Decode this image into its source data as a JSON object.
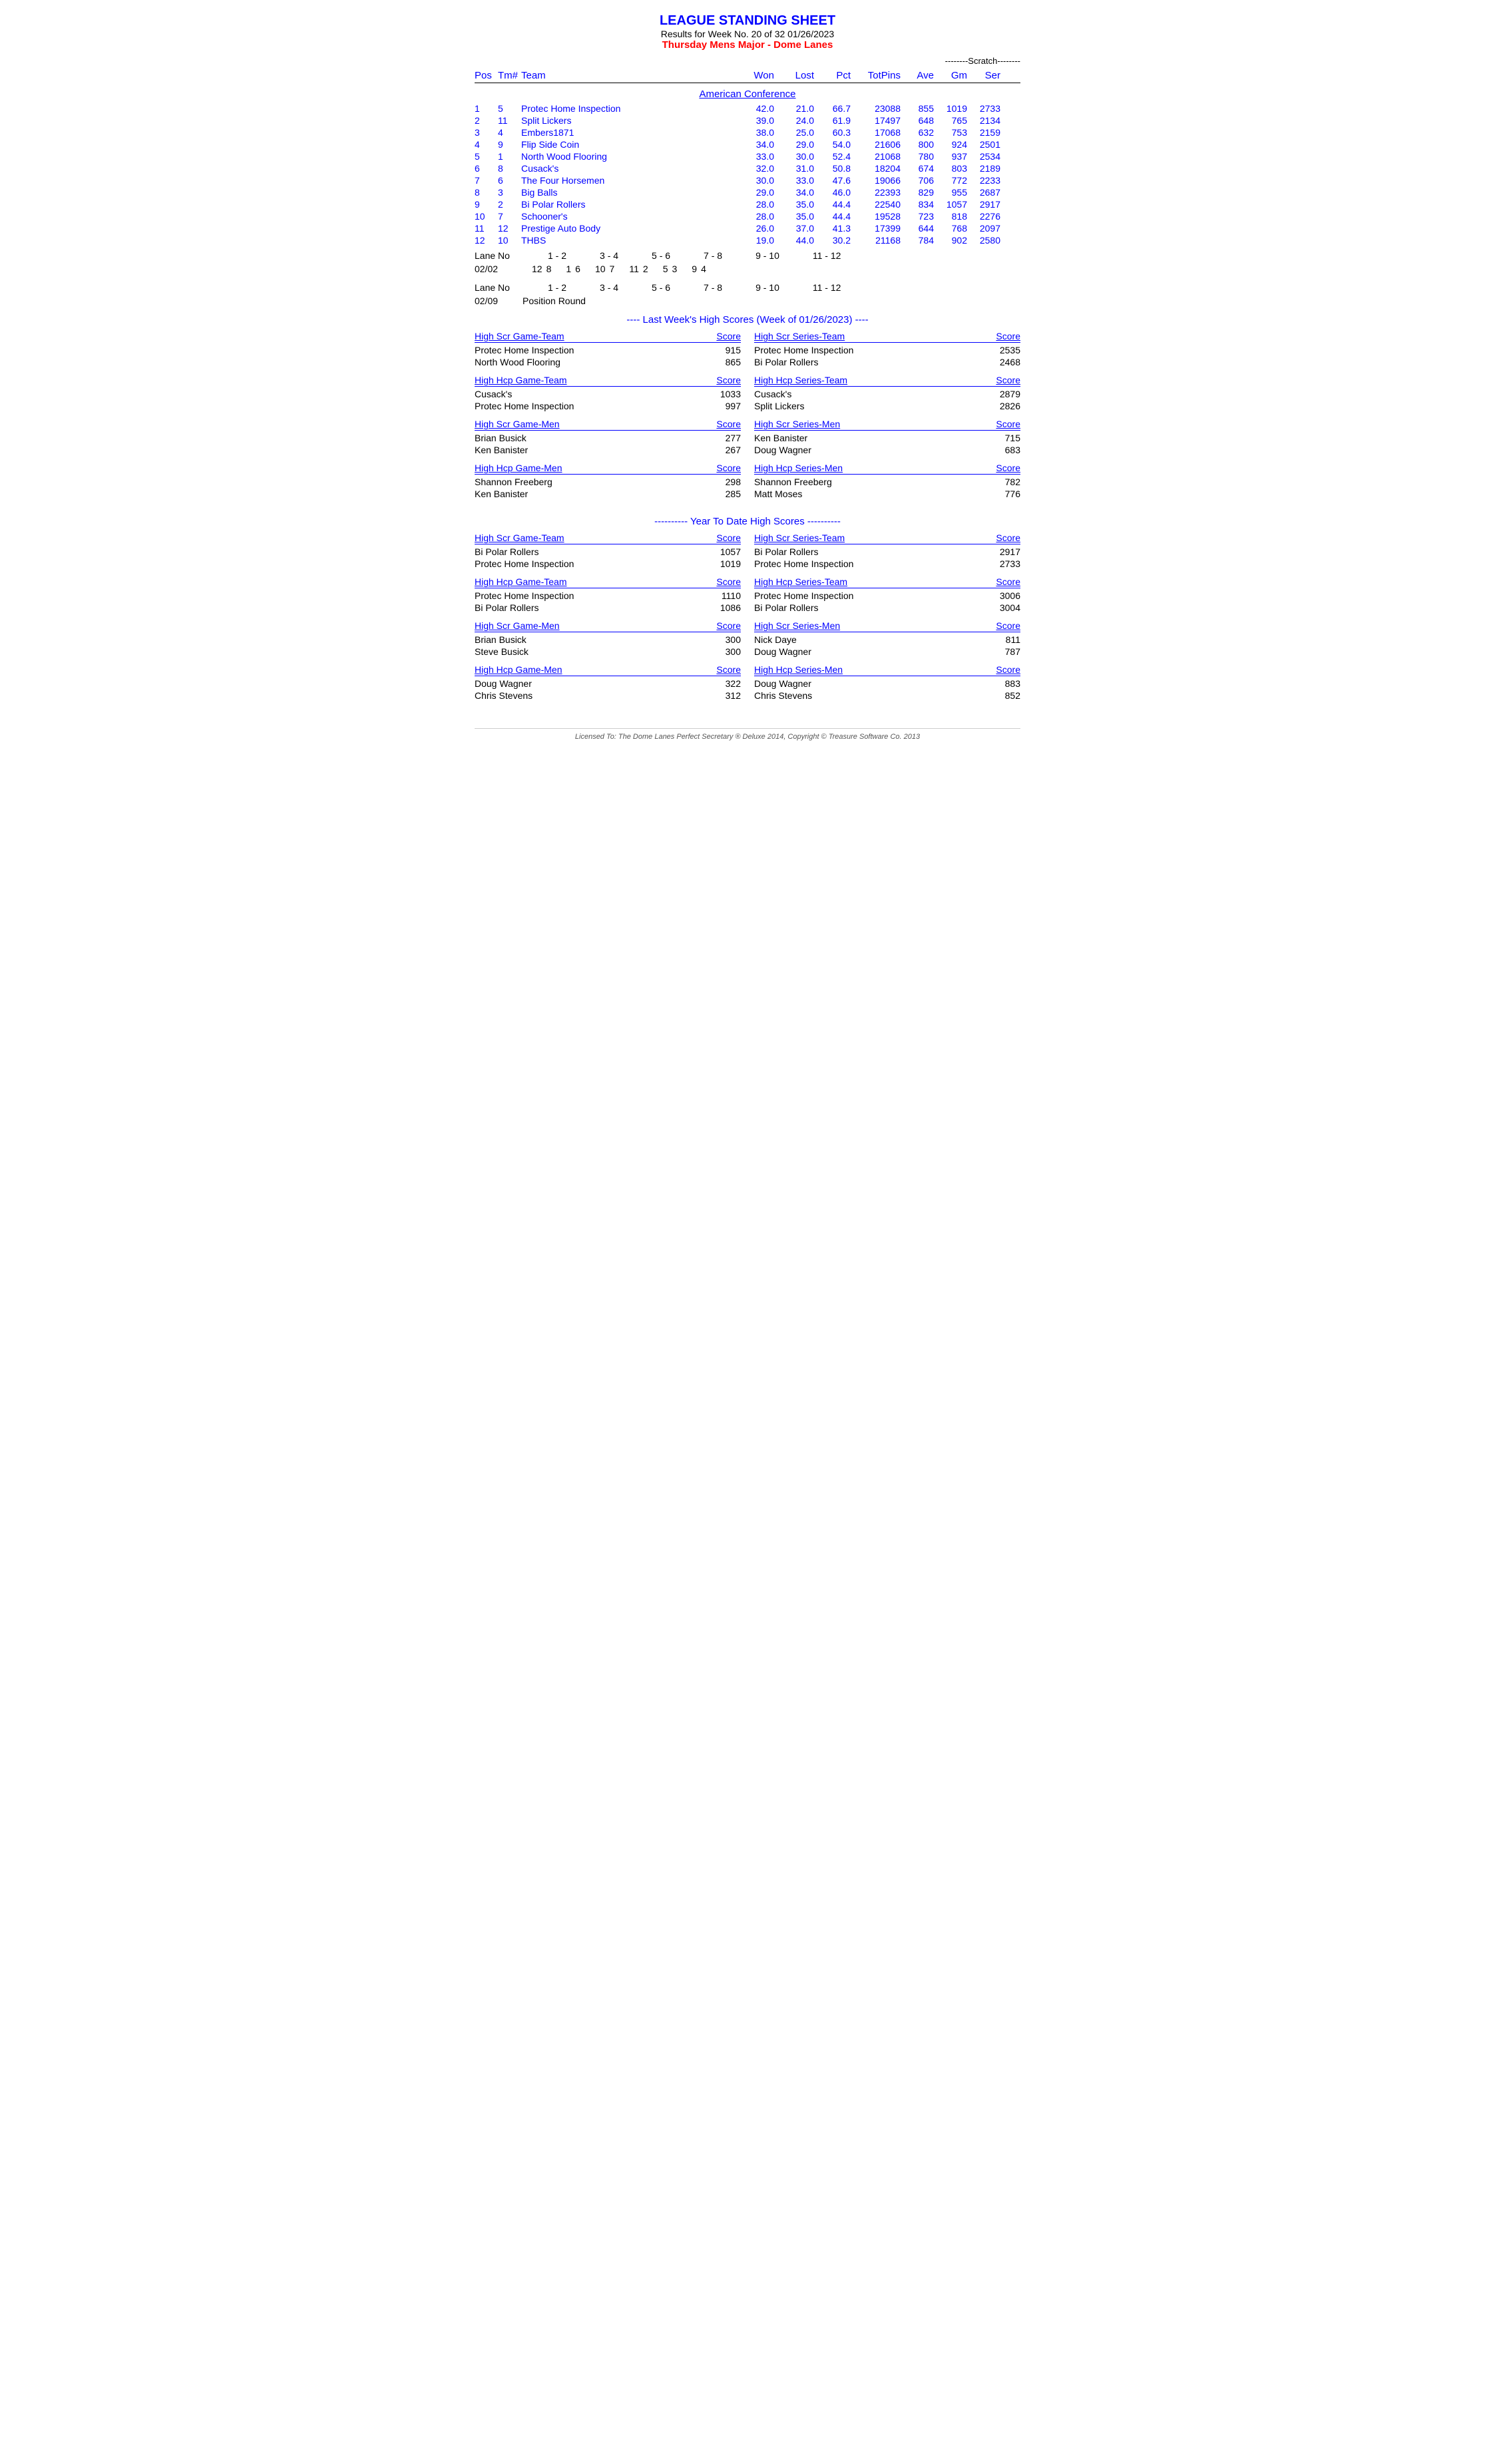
{
  "header": {
    "title": "LEAGUE STANDING SHEET",
    "subtitle": "Results for Week No. 20 of 32    01/26/2023",
    "league": "Thursday Mens Major - Dome Lanes"
  },
  "columns": {
    "pos": "Pos",
    "tm": "Tm#",
    "team": "Team",
    "won": "Won",
    "lost": "Lost",
    "pct": "Pct",
    "totpins": "TotPins",
    "ave": "Ave",
    "gm": "Gm",
    "ser": "Ser",
    "scratch_label": "--------Scratch--------"
  },
  "conference": {
    "name": "American Conference"
  },
  "teams": [
    {
      "pos": "1",
      "tm": "5",
      "team": "Protec Home Inspection",
      "won": "42.0",
      "lost": "21.0",
      "pct": "66.7",
      "totpins": "23088",
      "ave": "855",
      "gm": "1019",
      "ser": "2733"
    },
    {
      "pos": "2",
      "tm": "11",
      "team": "Split Lickers",
      "won": "39.0",
      "lost": "24.0",
      "pct": "61.9",
      "totpins": "17497",
      "ave": "648",
      "gm": "765",
      "ser": "2134"
    },
    {
      "pos": "3",
      "tm": "4",
      "team": "Embers1871",
      "won": "38.0",
      "lost": "25.0",
      "pct": "60.3",
      "totpins": "17068",
      "ave": "632",
      "gm": "753",
      "ser": "2159"
    },
    {
      "pos": "4",
      "tm": "9",
      "team": "Flip Side Coin",
      "won": "34.0",
      "lost": "29.0",
      "pct": "54.0",
      "totpins": "21606",
      "ave": "800",
      "gm": "924",
      "ser": "2501"
    },
    {
      "pos": "5",
      "tm": "1",
      "team": "North Wood Flooring",
      "won": "33.0",
      "lost": "30.0",
      "pct": "52.4",
      "totpins": "21068",
      "ave": "780",
      "gm": "937",
      "ser": "2534"
    },
    {
      "pos": "6",
      "tm": "8",
      "team": "Cusack's",
      "won": "32.0",
      "lost": "31.0",
      "pct": "50.8",
      "totpins": "18204",
      "ave": "674",
      "gm": "803",
      "ser": "2189"
    },
    {
      "pos": "7",
      "tm": "6",
      "team": "The Four Horsemen",
      "won": "30.0",
      "lost": "33.0",
      "pct": "47.6",
      "totpins": "19066",
      "ave": "706",
      "gm": "772",
      "ser": "2233"
    },
    {
      "pos": "8",
      "tm": "3",
      "team": "Big Balls",
      "won": "29.0",
      "lost": "34.0",
      "pct": "46.0",
      "totpins": "22393",
      "ave": "829",
      "gm": "955",
      "ser": "2687"
    },
    {
      "pos": "9",
      "tm": "2",
      "team": "Bi Polar Rollers",
      "won": "28.0",
      "lost": "35.0",
      "pct": "44.4",
      "totpins": "22540",
      "ave": "834",
      "gm": "1057",
      "ser": "2917"
    },
    {
      "pos": "10",
      "tm": "7",
      "team": "Schooner's",
      "won": "28.0",
      "lost": "35.0",
      "pct": "44.4",
      "totpins": "19528",
      "ave": "723",
      "gm": "818",
      "ser": "2276"
    },
    {
      "pos": "11",
      "tm": "12",
      "team": "Prestige Auto Body",
      "won": "26.0",
      "lost": "37.0",
      "pct": "41.3",
      "totpins": "17399",
      "ave": "644",
      "gm": "768",
      "ser": "2097"
    },
    {
      "pos": "12",
      "tm": "10",
      "team": "THBS",
      "won": "19.0",
      "lost": "44.0",
      "pct": "30.2",
      "totpins": "21168",
      "ave": "784",
      "gm": "902",
      "ser": "2580"
    }
  ],
  "lanes": {
    "header1": "Lane No",
    "row1_date": "02/02",
    "row1_range1": "1 - 2",
    "row1_range2": "3 - 4",
    "row1_range3": "5 - 6",
    "row1_range4": "7 - 8",
    "row1_range5": "9 - 10",
    "row1_range6": "11 - 12",
    "row1_val1": "12",
    "row1_val2": "8",
    "row1_val3": "1",
    "row1_val4": "6",
    "row1_val5": "10",
    "row1_val6": "7",
    "row1_val7": "11",
    "row1_val8": "2",
    "row1_val9": "5",
    "row1_val10": "3",
    "row1_val11": "9",
    "row1_val12": "4",
    "header2": "Lane No",
    "row2_date": "02/09",
    "row2_range1": "1 - 2",
    "row2_range2": "3 - 4",
    "row2_range3": "5 - 6",
    "row2_range4": "7 - 8",
    "row2_range5": "9 - 10",
    "row2_range6": "11 - 12",
    "row2_label": "Position Round"
  },
  "last_week": {
    "header": "----  Last Week's High Scores  (Week of 01/26/2023)  ----",
    "sections": [
      {
        "id": "high_scr_game_team",
        "label": "High Scr Game-Team",
        "score_label": "Score",
        "entries": [
          {
            "name": "Protec Home Inspection",
            "score": "915"
          },
          {
            "name": "North Wood Flooring",
            "score": "865"
          }
        ]
      },
      {
        "id": "high_scr_series_team",
        "label": "High Scr Series-Team",
        "score_label": "Score",
        "entries": [
          {
            "name": "Protec Home Inspection",
            "score": "2535"
          },
          {
            "name": "Bi Polar Rollers",
            "score": "2468"
          }
        ]
      },
      {
        "id": "high_hcp_game_team",
        "label": "High Hcp Game-Team",
        "score_label": "Score",
        "entries": [
          {
            "name": "Cusack's",
            "score": "1033"
          },
          {
            "name": "Protec Home Inspection",
            "score": "997"
          }
        ]
      },
      {
        "id": "high_hcp_series_team",
        "label": "High Hcp Series-Team",
        "score_label": "Score",
        "entries": [
          {
            "name": "Cusack's",
            "score": "2879"
          },
          {
            "name": "Split Lickers",
            "score": "2826"
          }
        ]
      },
      {
        "id": "high_scr_game_men",
        "label": "High Scr Game-Men",
        "score_label": "Score",
        "entries": [
          {
            "name": "Brian Busick",
            "score": "277"
          },
          {
            "name": "Ken Banister",
            "score": "267"
          }
        ]
      },
      {
        "id": "high_scr_series_men",
        "label": "High Scr Series-Men",
        "score_label": "Score",
        "entries": [
          {
            "name": "Ken Banister",
            "score": "715"
          },
          {
            "name": "Doug Wagner",
            "score": "683"
          }
        ]
      },
      {
        "id": "high_hcp_game_men",
        "label": "High Hcp Game-Men",
        "score_label": "Score",
        "entries": [
          {
            "name": "Shannon Freeberg",
            "score": "298"
          },
          {
            "name": "Ken Banister",
            "score": "285"
          }
        ]
      },
      {
        "id": "high_hcp_series_men",
        "label": "High Hcp Series-Men",
        "score_label": "Score",
        "entries": [
          {
            "name": "Shannon Freeberg",
            "score": "782"
          },
          {
            "name": "Matt Moses",
            "score": "776"
          }
        ]
      }
    ]
  },
  "ytd": {
    "header": "---------- Year To Date High Scores ----------",
    "sections": [
      {
        "id": "ytd_high_scr_game_team",
        "label": "High Scr Game-Team",
        "score_label": "Score",
        "entries": [
          {
            "name": "Bi Polar Rollers",
            "score": "1057"
          },
          {
            "name": "Protec Home Inspection",
            "score": "1019"
          }
        ]
      },
      {
        "id": "ytd_high_scr_series_team",
        "label": "High Scr Series-Team",
        "score_label": "Score",
        "entries": [
          {
            "name": "Bi Polar Rollers",
            "score": "2917"
          },
          {
            "name": "Protec Home Inspection",
            "score": "2733"
          }
        ]
      },
      {
        "id": "ytd_high_hcp_game_team",
        "label": "High Hcp Game-Team",
        "score_label": "Score",
        "entries": [
          {
            "name": "Protec Home Inspection",
            "score": "1110"
          },
          {
            "name": "Bi Polar Rollers",
            "score": "1086"
          }
        ]
      },
      {
        "id": "ytd_high_hcp_series_team",
        "label": "High Hcp Series-Team",
        "score_label": "Score",
        "entries": [
          {
            "name": "Protec Home Inspection",
            "score": "3006"
          },
          {
            "name": "Bi Polar Rollers",
            "score": "3004"
          }
        ]
      },
      {
        "id": "ytd_high_scr_game_men",
        "label": "High Scr Game-Men",
        "score_label": "Score",
        "entries": [
          {
            "name": "Brian Busick",
            "score": "300"
          },
          {
            "name": "Steve Busick",
            "score": "300"
          }
        ]
      },
      {
        "id": "ytd_high_scr_series_men",
        "label": "High Scr Series-Men",
        "score_label": "Score",
        "entries": [
          {
            "name": "Nick Daye",
            "score": "811"
          },
          {
            "name": "Doug Wagner",
            "score": "787"
          }
        ]
      },
      {
        "id": "ytd_high_hcp_game_men",
        "label": "High Hcp Game-Men",
        "score_label": "Score",
        "entries": [
          {
            "name": "Doug Wagner",
            "score": "322"
          },
          {
            "name": "Chris Stevens",
            "score": "312"
          }
        ]
      },
      {
        "id": "ytd_high_hcp_series_men",
        "label": "High Hcp Series-Men",
        "score_label": "Score",
        "entries": [
          {
            "name": "Doug Wagner",
            "score": "883"
          },
          {
            "name": "Chris Stevens",
            "score": "852"
          }
        ]
      }
    ]
  },
  "footer": {
    "text": "Licensed To: The Dome Lanes    Perfect Secretary ® Deluxe  2014, Copyright © Treasure Software Co. 2013"
  }
}
